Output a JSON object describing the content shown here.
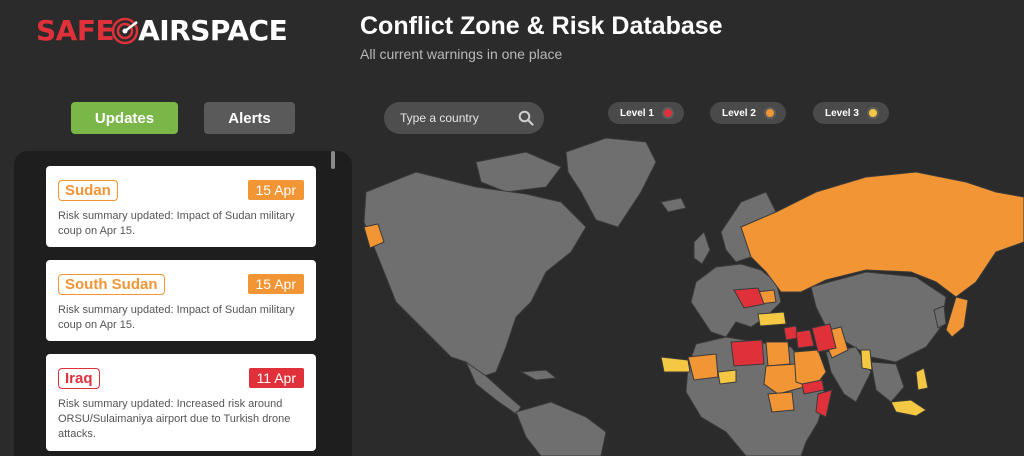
{
  "logo": {
    "part1": "SAFE",
    "part2": "AIRSPACE"
  },
  "header": {
    "title": "Conflict Zone & Risk Database",
    "subtitle": "All current warnings in one place"
  },
  "tabs": [
    {
      "label": "Updates",
      "active": true
    },
    {
      "label": "Alerts",
      "active": false
    }
  ],
  "search": {
    "placeholder": "Type a country",
    "icon": "search-icon"
  },
  "levels": [
    {
      "label": "Level 1",
      "color": "#e0313a"
    },
    {
      "label": "Level 2",
      "color": "#f19535"
    },
    {
      "label": "Level 3",
      "color": "#f4c843"
    }
  ],
  "updates": [
    {
      "country": "Sudan",
      "date": "15 Apr",
      "level": "orange",
      "summary": "Risk summary updated: Impact of Sudan military coup on Apr 15."
    },
    {
      "country": "South Sudan",
      "date": "15 Apr",
      "level": "orange",
      "summary": "Risk summary updated: Impact of Sudan military coup on Apr 15."
    },
    {
      "country": "Iraq",
      "date": "11 Apr",
      "level": "red",
      "summary": "Risk summary updated: Increased risk around ORSU/Sulaimaniya airport due to Turkish drone attacks."
    }
  ],
  "colors": {
    "background": "#2b2b2b",
    "land": "#6f6f6f",
    "level1": "#e0313a",
    "level2": "#f19535",
    "level3": "#f4c843",
    "accent_green": "#7ab648"
  }
}
